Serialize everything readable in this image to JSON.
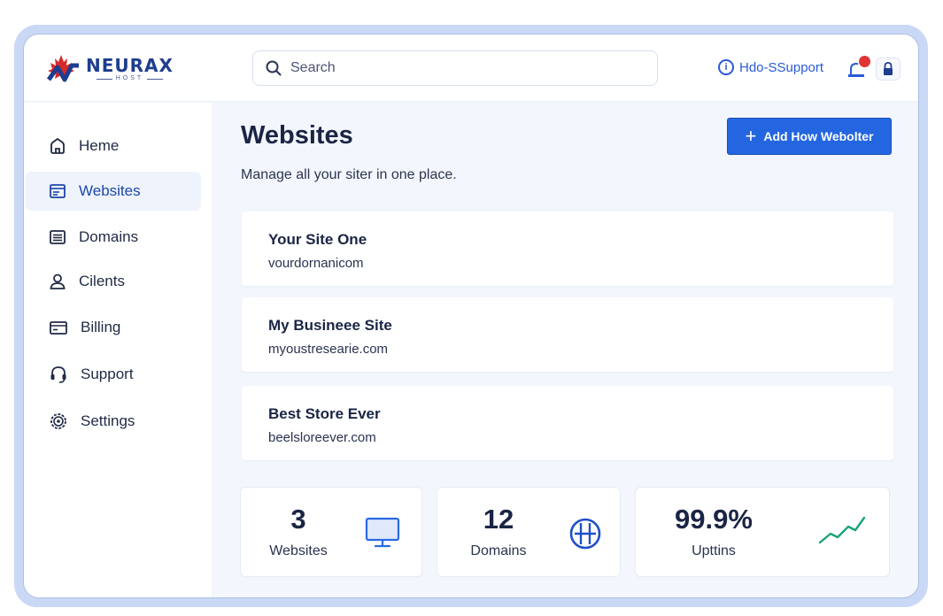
{
  "brand": {
    "name": "NEURAX",
    "sub": "HOST"
  },
  "search": {
    "placeholder": "Search"
  },
  "header": {
    "support_label": "Hdo-SSupport"
  },
  "sidebar": {
    "items": [
      {
        "label": "Heme",
        "icon": "home-icon",
        "active": false
      },
      {
        "label": "Websites",
        "icon": "websites-icon",
        "active": true
      },
      {
        "label": "Domains",
        "icon": "domains-icon",
        "active": false
      },
      {
        "label": "Cilents",
        "icon": "user-icon",
        "active": false
      },
      {
        "label": "Billing",
        "icon": "billing-icon",
        "active": false
      },
      {
        "label": "Support",
        "icon": "headset-icon",
        "active": false
      },
      {
        "label": "Settings",
        "icon": "gear-icon",
        "active": false
      }
    ]
  },
  "main": {
    "title": "Websites",
    "subtitle": "Manage all your  siter in one place.",
    "add_button": "Add How Webolter",
    "sites": [
      {
        "name": "Your Site One",
        "domain": "vourdornanicom"
      },
      {
        "name": "My Busineee Site",
        "domain": "myoustresearie.com"
      },
      {
        "name": "Best Store Ever",
        "domain": "beelsloreever.com"
      }
    ],
    "stats": [
      {
        "value": "3",
        "label": "Websites",
        "icon": "monitor-icon"
      },
      {
        "value": "12",
        "label": "Domains",
        "icon": "network-icon"
      },
      {
        "value": "99.9%",
        "label": "Upttins",
        "icon": "trend-line-icon"
      }
    ]
  },
  "colors": {
    "accent": "#2466e0",
    "brand": "#1e3d8f",
    "notification": "#e03434",
    "trend": "#1aa37a",
    "logo_leaf": "#d42a2a"
  }
}
